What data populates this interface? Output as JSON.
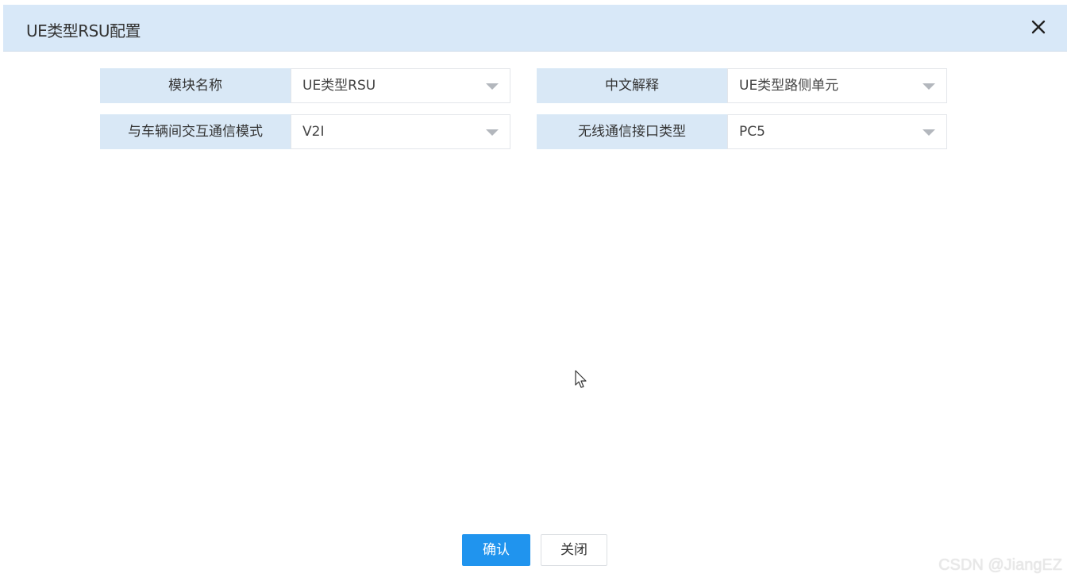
{
  "dialog": {
    "title": "UE类型RSU配置",
    "close_icon": "close-icon"
  },
  "form": {
    "fields": [
      {
        "label": "模块名称",
        "value": "UE类型RSU"
      },
      {
        "label": "中文解释",
        "value": "UE类型路侧单元"
      },
      {
        "label": "与车辆间交互通信模式",
        "value": "V2I"
      },
      {
        "label": "无线通信接口类型",
        "value": "PC5"
      }
    ]
  },
  "buttons": {
    "confirm": "确认",
    "close": "关闭"
  },
  "watermark": "CSDN @JiangEZ",
  "colors": {
    "titlebar_bg": "#d8e8f8",
    "label_bg": "#d9e8f6",
    "primary_button": "#2094ee"
  }
}
